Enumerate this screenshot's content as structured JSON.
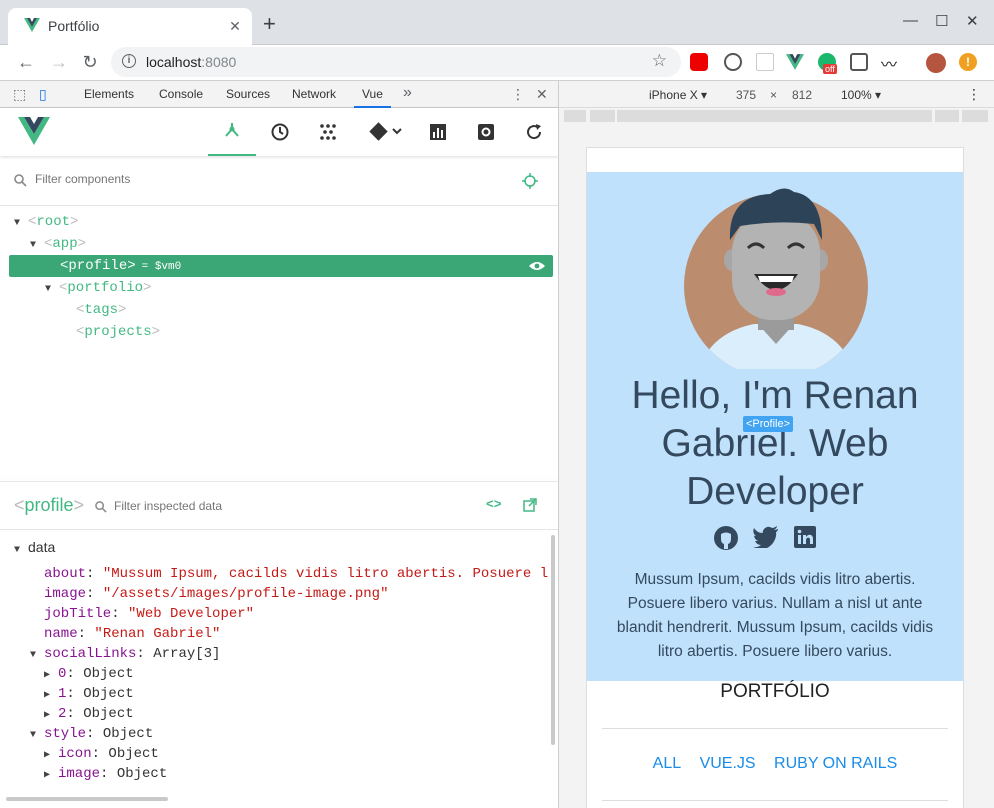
{
  "browser": {
    "tab_title": "Portfólio",
    "tab_close": "✕",
    "new_tab": "+",
    "url_host": "localhost",
    "url_port": ":8080"
  },
  "devtools": {
    "tabs": [
      "Elements",
      "Console",
      "Sources",
      "Network",
      "Vue"
    ],
    "more": "»"
  },
  "vue": {
    "filter_placeholder": "Filter components",
    "tree": [
      {
        "name": "root",
        "open": true
      },
      {
        "name": "app",
        "open": true
      },
      {
        "name": "profile",
        "selected": true,
        "vm": "= $vm0"
      },
      {
        "name": "portfolio",
        "open": true
      },
      {
        "name": "tags"
      },
      {
        "name": "projects"
      }
    ],
    "inspected_component": "profile",
    "inspect_filter_placeholder": "Filter inspected data",
    "data_section": "data",
    "data": {
      "about": {
        "key": "about",
        "value": "\"Mussum Ipsum, cacilds vidis litro abertis. Posuere l"
      },
      "image": {
        "key": "image",
        "value": "\"/assets/images/profile-image.png\""
      },
      "jobTitle": {
        "key": "jobTitle",
        "value": "\"Web Developer\""
      },
      "name": {
        "key": "name",
        "value": "\"Renan Gabriel\""
      },
      "socialLinks": {
        "key": "socialLinks",
        "value": "Array[3]"
      },
      "s0": {
        "key": "0",
        "value": "Object"
      },
      "s1": {
        "key": "1",
        "value": "Object"
      },
      "s2": {
        "key": "2",
        "value": "Object"
      },
      "style": {
        "key": "style",
        "value": "Object"
      },
      "icon": {
        "key": "icon",
        "value": "Object"
      },
      "imgstyle": {
        "key": "image",
        "value": "Object"
      }
    }
  },
  "device": {
    "model": "iPhone X ▾",
    "width": "375",
    "times": "×",
    "height": "812",
    "zoom": "100% ▾"
  },
  "page": {
    "hello": "Hello, I'm Renan Gabriel. Web Developer",
    "component_tag": "<Profile>",
    "bio": "Mussum Ipsum, cacilds vidis litro abertis. Posuere libero varius. Nullam a nisl ut ante blandit hendrerit. Mussum Ipsum, cacilds vidis litro abertis. Posuere libero varius.",
    "section_title": "PORTFÓLIO",
    "filters": [
      "ALL",
      "VUE.JS",
      "RUBY ON RAILS"
    ]
  },
  "colors": {
    "vue_green": "#42b983",
    "selected_row": "#3ba776",
    "hero_bg": "#bfe1fb",
    "link_blue": "#1a8ce8"
  }
}
